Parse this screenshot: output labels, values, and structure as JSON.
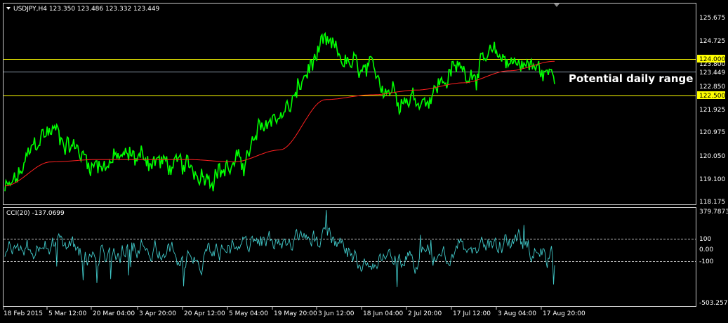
{
  "header": {
    "symbol_info": "USDJPY,H4  123.350 123.486 123.332 123.449"
  },
  "price_axis": {
    "ticks": [
      "125.675",
      "124.725",
      "123.800",
      "122.850",
      "121.925",
      "120.975",
      "120.050",
      "119.100",
      "118.175"
    ],
    "tick_values": [
      125.675,
      124.725,
      123.8,
      122.85,
      121.925,
      120.975,
      120.05,
      119.1,
      118.175
    ],
    "range": [
      118.03,
      126.41
    ]
  },
  "levels": [
    {
      "label": "124.000",
      "value": 124.0,
      "color": "#ffff00"
    },
    {
      "label": "122.500",
      "value": 122.5,
      "color": "#ffff00"
    }
  ],
  "current_price": {
    "label": "123.449",
    "value": 123.449,
    "color": "#c0c0c0"
  },
  "annotation": "Potential daily range",
  "cci": {
    "title": "CCI(20) -137.0699",
    "max_label": "379.7873",
    "min_label": "-503.2579",
    "ticks": [
      "100",
      "0.00",
      "-100"
    ],
    "tick_values": [
      100,
      0,
      -100
    ],
    "range": [
      -503.2579,
      379.7873
    ],
    "color": "#40c8c8"
  },
  "time_axis": {
    "labels": [
      "18 Feb 2015",
      "5 Mar 12:00",
      "20 Mar 04:00",
      "3 Apr 20:00",
      "20 Apr 12:00",
      "5 May 04:00",
      "19 May 20:00",
      "3 Jun 12:00",
      "18 Jun 04:00",
      "2 Jul 20:00",
      "17 Jul 12:00",
      "3 Aug 04:00",
      "17 Aug 20:00"
    ]
  },
  "chart_data": {
    "type": "line",
    "title": "USDJPY,H4",
    "x": [
      "18 Feb 2015",
      "5 Mar 12:00",
      "20 Mar 04:00",
      "3 Apr 20:00",
      "20 Apr 12:00",
      "5 May 04:00",
      "19 May 20:00",
      "3 Jun 12:00",
      "18 Jun 04:00",
      "2 Jul 20:00",
      "17 Jul 12:00",
      "3 Aug 04:00",
      "17 Aug 20:00"
    ],
    "series": [
      {
        "name": "USDJPY",
        "color": "#00ff00",
        "values": [
          118.6,
          121.1,
          119.8,
          120.0,
          119.4,
          119.6,
          121.8,
          124.4,
          123.3,
          122.5,
          123.7,
          124.1,
          123.4
        ]
      },
      {
        "name": "",
        "color": "#ff2020",
        "values": [
          118.8,
          119.8,
          119.9,
          119.9,
          119.9,
          119.8,
          120.3,
          122.4,
          122.6,
          122.8,
          123.1,
          123.6,
          124.0
        ]
      },
      {
        "name": "CCI(20)",
        "color": "#40c8c8",
        "values": [
          -50,
          120,
          -80,
          90,
          -120,
          40,
          230,
          180,
          -150,
          -220,
          110,
          170,
          -137
        ]
      }
    ],
    "ylim": [
      118.03,
      126.41
    ]
  }
}
